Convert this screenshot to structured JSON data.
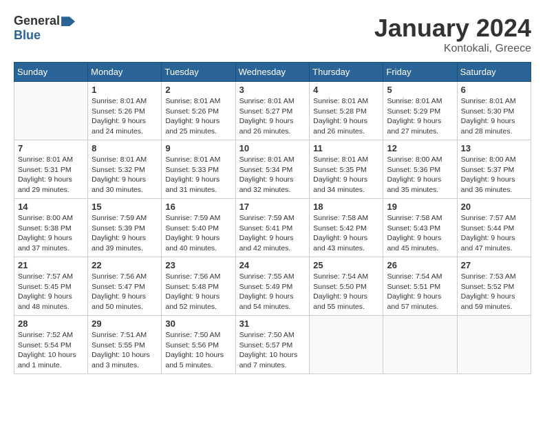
{
  "header": {
    "logo_general": "General",
    "logo_blue": "Blue",
    "month_title": "January 2024",
    "location": "Kontokali, Greece"
  },
  "days_of_week": [
    "Sunday",
    "Monday",
    "Tuesday",
    "Wednesday",
    "Thursday",
    "Friday",
    "Saturday"
  ],
  "weeks": [
    [
      {
        "day": "",
        "info": ""
      },
      {
        "day": "1",
        "info": "Sunrise: 8:01 AM\nSunset: 5:26 PM\nDaylight: 9 hours\nand 24 minutes."
      },
      {
        "day": "2",
        "info": "Sunrise: 8:01 AM\nSunset: 5:26 PM\nDaylight: 9 hours\nand 25 minutes."
      },
      {
        "day": "3",
        "info": "Sunrise: 8:01 AM\nSunset: 5:27 PM\nDaylight: 9 hours\nand 26 minutes."
      },
      {
        "day": "4",
        "info": "Sunrise: 8:01 AM\nSunset: 5:28 PM\nDaylight: 9 hours\nand 26 minutes."
      },
      {
        "day": "5",
        "info": "Sunrise: 8:01 AM\nSunset: 5:29 PM\nDaylight: 9 hours\nand 27 minutes."
      },
      {
        "day": "6",
        "info": "Sunrise: 8:01 AM\nSunset: 5:30 PM\nDaylight: 9 hours\nand 28 minutes."
      }
    ],
    [
      {
        "day": "7",
        "info": "Sunrise: 8:01 AM\nSunset: 5:31 PM\nDaylight: 9 hours\nand 29 minutes."
      },
      {
        "day": "8",
        "info": "Sunrise: 8:01 AM\nSunset: 5:32 PM\nDaylight: 9 hours\nand 30 minutes."
      },
      {
        "day": "9",
        "info": "Sunrise: 8:01 AM\nSunset: 5:33 PM\nDaylight: 9 hours\nand 31 minutes."
      },
      {
        "day": "10",
        "info": "Sunrise: 8:01 AM\nSunset: 5:34 PM\nDaylight: 9 hours\nand 32 minutes."
      },
      {
        "day": "11",
        "info": "Sunrise: 8:01 AM\nSunset: 5:35 PM\nDaylight: 9 hours\nand 34 minutes."
      },
      {
        "day": "12",
        "info": "Sunrise: 8:00 AM\nSunset: 5:36 PM\nDaylight: 9 hours\nand 35 minutes."
      },
      {
        "day": "13",
        "info": "Sunrise: 8:00 AM\nSunset: 5:37 PM\nDaylight: 9 hours\nand 36 minutes."
      }
    ],
    [
      {
        "day": "14",
        "info": "Sunrise: 8:00 AM\nSunset: 5:38 PM\nDaylight: 9 hours\nand 37 minutes."
      },
      {
        "day": "15",
        "info": "Sunrise: 7:59 AM\nSunset: 5:39 PM\nDaylight: 9 hours\nand 39 minutes."
      },
      {
        "day": "16",
        "info": "Sunrise: 7:59 AM\nSunset: 5:40 PM\nDaylight: 9 hours\nand 40 minutes."
      },
      {
        "day": "17",
        "info": "Sunrise: 7:59 AM\nSunset: 5:41 PM\nDaylight: 9 hours\nand 42 minutes."
      },
      {
        "day": "18",
        "info": "Sunrise: 7:58 AM\nSunset: 5:42 PM\nDaylight: 9 hours\nand 43 minutes."
      },
      {
        "day": "19",
        "info": "Sunrise: 7:58 AM\nSunset: 5:43 PM\nDaylight: 9 hours\nand 45 minutes."
      },
      {
        "day": "20",
        "info": "Sunrise: 7:57 AM\nSunset: 5:44 PM\nDaylight: 9 hours\nand 47 minutes."
      }
    ],
    [
      {
        "day": "21",
        "info": "Sunrise: 7:57 AM\nSunset: 5:45 PM\nDaylight: 9 hours\nand 48 minutes."
      },
      {
        "day": "22",
        "info": "Sunrise: 7:56 AM\nSunset: 5:47 PM\nDaylight: 9 hours\nand 50 minutes."
      },
      {
        "day": "23",
        "info": "Sunrise: 7:56 AM\nSunset: 5:48 PM\nDaylight: 9 hours\nand 52 minutes."
      },
      {
        "day": "24",
        "info": "Sunrise: 7:55 AM\nSunset: 5:49 PM\nDaylight: 9 hours\nand 54 minutes."
      },
      {
        "day": "25",
        "info": "Sunrise: 7:54 AM\nSunset: 5:50 PM\nDaylight: 9 hours\nand 55 minutes."
      },
      {
        "day": "26",
        "info": "Sunrise: 7:54 AM\nSunset: 5:51 PM\nDaylight: 9 hours\nand 57 minutes."
      },
      {
        "day": "27",
        "info": "Sunrise: 7:53 AM\nSunset: 5:52 PM\nDaylight: 9 hours\nand 59 minutes."
      }
    ],
    [
      {
        "day": "28",
        "info": "Sunrise: 7:52 AM\nSunset: 5:54 PM\nDaylight: 10 hours\nand 1 minute."
      },
      {
        "day": "29",
        "info": "Sunrise: 7:51 AM\nSunset: 5:55 PM\nDaylight: 10 hours\nand 3 minutes."
      },
      {
        "day": "30",
        "info": "Sunrise: 7:50 AM\nSunset: 5:56 PM\nDaylight: 10 hours\nand 5 minutes."
      },
      {
        "day": "31",
        "info": "Sunrise: 7:50 AM\nSunset: 5:57 PM\nDaylight: 10 hours\nand 7 minutes."
      },
      {
        "day": "",
        "info": ""
      },
      {
        "day": "",
        "info": ""
      },
      {
        "day": "",
        "info": ""
      }
    ]
  ]
}
